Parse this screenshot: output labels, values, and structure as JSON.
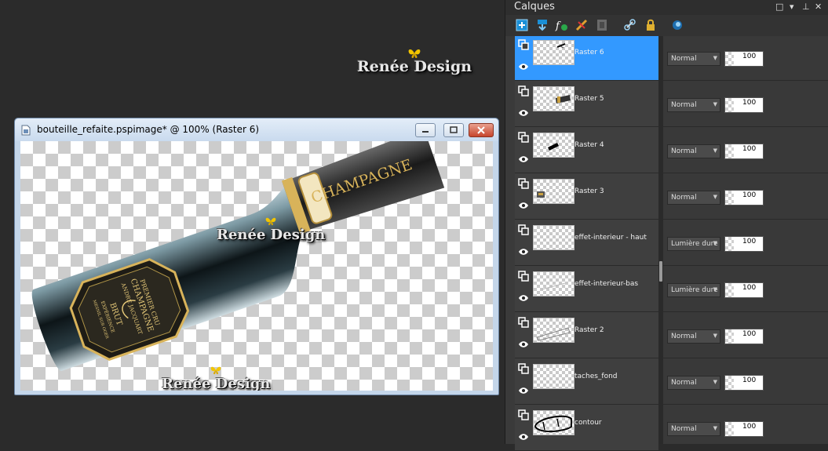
{
  "watermark": {
    "text": "Renée Design",
    "butterfly_color": "#f2c500"
  },
  "document": {
    "title": "bouteille_refaite.pspimage* @ 100% (Raster 6)",
    "label": {
      "neck_text": "CHAMPAGNE",
      "line1": "PREMIER CRU",
      "line2": "CHAMPAGNE",
      "line3": "ANDRÉ JACQUART",
      "line4": "BRUT",
      "line5": "EXPÉRIENCE",
      "line6": "MESNIL SUR OGER"
    }
  },
  "panel": {
    "title": "Calques",
    "header_controls": [
      "□",
      "▾",
      "⊥",
      "✕"
    ],
    "toolbar_icons": [
      "new-layer-icon",
      "merge-down-icon",
      "fx-icon",
      "delete-layer-icon",
      "layer-mask-icon",
      "link-icon",
      "lock-icon",
      "blend-icon"
    ],
    "layers": [
      {
        "name": "Raster 6",
        "blend": "Normal",
        "opacity": "100",
        "opacity_fill": 0.22,
        "selected": true,
        "thumb": "stroke"
      },
      {
        "name": "Raster 5",
        "blend": "Normal",
        "opacity": "100",
        "opacity_fill": 0.22,
        "selected": false,
        "thumb": "neck"
      },
      {
        "name": "Raster 4",
        "blend": "Normal",
        "opacity": "100",
        "opacity_fill": 0.22,
        "selected": false,
        "thumb": "blob"
      },
      {
        "name": "Raster 3",
        "blend": "Normal",
        "opacity": "100",
        "opacity_fill": 0.22,
        "selected": false,
        "thumb": "small"
      },
      {
        "name": "effet-interieur - haut",
        "blend": "Lumière dure",
        "opacity": "100",
        "opacity_fill": 0.22,
        "selected": false,
        "thumb": "empty"
      },
      {
        "name": "effet-interieur-bas",
        "blend": "Lumière dure",
        "opacity": "100",
        "opacity_fill": 0.22,
        "selected": false,
        "thumb": "faint"
      },
      {
        "name": "Raster 2",
        "blend": "Normal",
        "opacity": "100",
        "opacity_fill": 0.22,
        "selected": false,
        "thumb": "outline"
      },
      {
        "name": "taches_fond",
        "blend": "Normal",
        "opacity": "100",
        "opacity_fill": 0.22,
        "selected": false,
        "thumb": "empty"
      },
      {
        "name": "contour",
        "blend": "Normal",
        "opacity": "100",
        "opacity_fill": 0.22,
        "selected": false,
        "thumb": "contour"
      }
    ]
  },
  "colors": {
    "selection": "#3399ff",
    "panel_bg": "#3a3a3a",
    "workspace": "#2b2b2b",
    "gold": "#d8b35a"
  }
}
